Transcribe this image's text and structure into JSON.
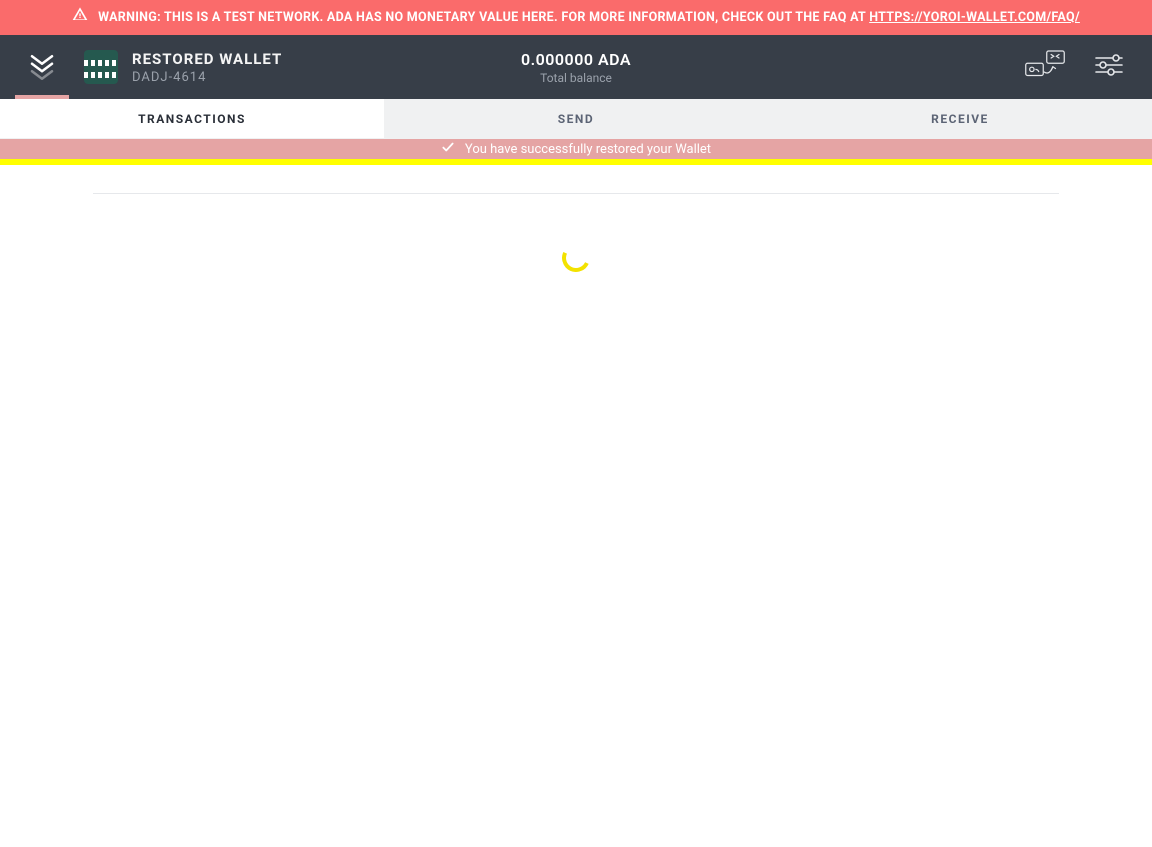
{
  "warning": {
    "text_prefix": "WARNING: THIS IS A TEST NETWORK. ADA HAS NO MONETARY VALUE HERE. FOR MORE INFORMATION, CHECK OUT THE FAQ AT ",
    "link_text": "HTTPS://YOROI-WALLET.COM/FAQ/"
  },
  "header": {
    "wallet_name": "RESTORED WALLET",
    "wallet_id": "DADJ-4614",
    "balance_amount": "0.000000 ADA",
    "balance_label": "Total balance"
  },
  "tabs": [
    {
      "key": "transactions",
      "label": "TRANSACTIONS",
      "active": true
    },
    {
      "key": "send",
      "label": "SEND",
      "active": false
    },
    {
      "key": "receive",
      "label": "RECEIVE",
      "active": false
    }
  ],
  "notice": {
    "message": "You have successfully restored your Wallet"
  },
  "colors": {
    "warning_bg": "#fa6b6b",
    "header_bg": "#373e48",
    "notice_bg": "#e5a4a4",
    "accent_yellow": "#ffff00",
    "spinner": "#f3e200"
  }
}
